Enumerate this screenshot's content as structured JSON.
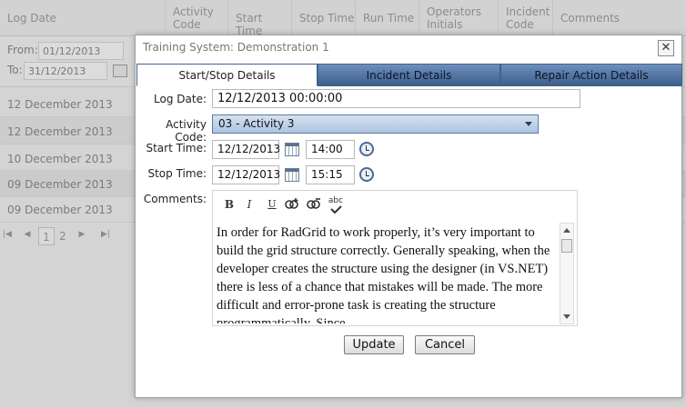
{
  "grid": {
    "columns": [
      "Log Date",
      "Activity Code",
      "Start Time",
      "Stop Time",
      "Run Time",
      "Operators Initials",
      "Incident Code",
      "Comments"
    ],
    "filter": {
      "from_label": "From:",
      "from_value": "01/12/2013",
      "to_label": "To:",
      "to_value": "31/12/2013"
    },
    "rows": [
      "12 December 2013",
      "12 December 2013",
      "10 December 2013",
      "09 December 2013",
      "09 December 2013"
    ],
    "pager": {
      "pages": [
        "1",
        "2"
      ],
      "current": "1"
    }
  },
  "dialog": {
    "title": "Training System: Demonstration 1",
    "close_symbol": "✕",
    "tabs": [
      "Start/Stop Details",
      "Incident Details",
      "Repair Action Details"
    ],
    "active_tab": "Start/Stop Details",
    "form": {
      "log_date_label": "Log Date:",
      "log_date_value": "12/12/2013 00:00:00",
      "activity_code_label": "Activity Code:",
      "activity_code_value": "03 - Activity 3",
      "start_time_label": "Start Time:",
      "start_date_value": "12/12/2013",
      "start_time_value": "14:00",
      "stop_time_label": "Stop Time:",
      "stop_date_value": "12/12/2013",
      "stop_time_value": "15:15",
      "comments_label": "Comments:",
      "toolbar": {
        "bold": "B",
        "italic": "I",
        "underline": "U",
        "spell": "abc"
      },
      "comments_text": "In order for RadGrid to work properly, it’s very important to build the grid structure correctly. Generally speaking, when the developer creates the structure using the designer (in VS.NET) there is less of a chance that mistakes will be made. The more difficult and error-prone task is creating the structure programmatically. Since"
    },
    "update_label": "Update",
    "cancel_label": "Cancel"
  },
  "colors": {
    "tab_active_bg": "#ffffff",
    "tab_inactive_bg": "#4f6f9c",
    "select_bg": "#c4d5ea",
    "overlay": "#d4d4d4"
  },
  "icons": [
    "calendar-icon",
    "clock-icon",
    "close-icon",
    "bold-icon",
    "italic-icon",
    "underline-icon",
    "insert-link-icon",
    "remove-link-icon",
    "spellcheck-icon",
    "chevron-down-icon"
  ]
}
